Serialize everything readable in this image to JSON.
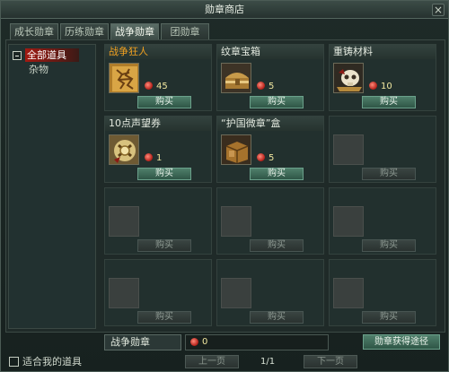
{
  "window": {
    "title": "勋章商店",
    "close_symbol": "×"
  },
  "tabs": [
    {
      "label": "成长勋章",
      "active": false
    },
    {
      "label": "历练勋章",
      "active": false
    },
    {
      "label": "战争勋章",
      "active": true
    },
    {
      "label": "团勋章",
      "active": false
    }
  ],
  "sidebar": {
    "categories": [
      {
        "label": "全部道具",
        "selected": true
      },
      {
        "label": "杂物",
        "selected": false
      }
    ]
  },
  "items": [
    {
      "name": "战争狂人",
      "name_color": "#f0a020",
      "icon": "rune-tablet-icon",
      "price": "45",
      "buy_label": "购买"
    },
    {
      "name": "纹章宝箱",
      "name_color": "#e3e9df",
      "icon": "treasure-chest-icon",
      "price": "5",
      "buy_label": "购买"
    },
    {
      "name": "重铸材料",
      "name_color": "#e3e9df",
      "icon": "skull-material-icon",
      "price": "10",
      "buy_label": "购买"
    },
    {
      "name": "10点声望券",
      "name_color": "#e3e9df",
      "icon": "reputation-coupon-icon",
      "price": "1",
      "buy_label": "购买"
    },
    {
      "name": "“护国微章”盒",
      "name_color": "#e3e9df",
      "icon": "badge-box-icon",
      "price": "5",
      "buy_label": "购买"
    }
  ],
  "empty_slot": {
    "buy_label": "购买"
  },
  "footer": {
    "currency_name": "战争勋章",
    "balance": "0",
    "obtain_label": "勋章获得途径"
  },
  "bottom": {
    "filter_label": "适合我的道具",
    "prev_label": "上一页",
    "page_indicator": "1/1",
    "next_label": "下一页"
  }
}
